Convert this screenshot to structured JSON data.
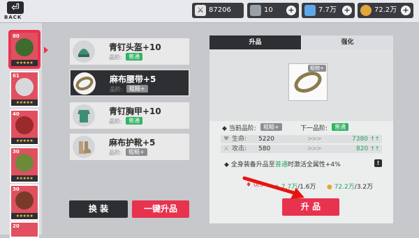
{
  "topbar": {
    "back_label": "BACK",
    "resources": [
      {
        "name": "power",
        "icon": "crossed-swords-icon",
        "value": "87206",
        "has_plus": false
      },
      {
        "name": "stone",
        "icon": "ore-icon",
        "value": "10",
        "has_plus": true
      },
      {
        "name": "diamond",
        "icon": "blue-crystal-icon",
        "value": "7.7万",
        "has_plus": true
      },
      {
        "name": "gold",
        "icon": "gold-coin-icon",
        "value": "72.2万",
        "has_plus": true
      }
    ]
  },
  "heroes": [
    {
      "level": "80",
      "stars": "★★★★★",
      "color": "#e05060",
      "selected": true
    },
    {
      "level": "61",
      "stars": "★★★★★",
      "color": "#e05060",
      "selected": false
    },
    {
      "level": "40",
      "stars": "★★★★★",
      "color": "#e05060",
      "selected": false
    },
    {
      "level": "30",
      "stars": "★★★★★",
      "color": "#e05060",
      "selected": false
    },
    {
      "level": "30",
      "stars": "★★★★★",
      "color": "#e05060",
      "selected": false
    },
    {
      "level": "20",
      "stars": "★★★★★",
      "color": "#e05060",
      "selected": false
    }
  ],
  "equipment": [
    {
      "name": "青钉头盔+10",
      "grade_label": "品阶:",
      "grade": "普通",
      "grade_style": "green",
      "selected": false
    },
    {
      "name": "麻布腰带+5",
      "grade_label": "品阶:",
      "grade": "粗糙+",
      "grade_style": "gray",
      "selected": true
    },
    {
      "name": "青钉胸甲+10",
      "grade_label": "品阶:",
      "grade": "普通",
      "grade_style": "green",
      "selected": false
    },
    {
      "name": "麻布护靴+5",
      "grade_label": "品阶:",
      "grade": "粗糙+",
      "grade_style": "gray",
      "selected": false
    }
  ],
  "buttons": {
    "swap": "换 装",
    "one_click": "一键升品",
    "upgrade": "升 品"
  },
  "tabs": {
    "upgrade_grade": "升品",
    "enhance": "强化"
  },
  "detail": {
    "item_badge": "粗糙+",
    "current_grade_label": "当前品阶:",
    "current_grade": "粗糙+",
    "next_grade_label": "下一品阶:",
    "next_grade": "普通",
    "stats": [
      {
        "label": "生命:",
        "icon": "heart-icon",
        "current": "5220",
        "next": "7380",
        "arrows": "↑↑"
      },
      {
        "label": "攻击:",
        "icon": "sword-icon",
        "current": "580",
        "next": "820",
        "arrows": "↑↑"
      }
    ],
    "note_prefix": "全身装备升品至",
    "note_grade": "普通",
    "note_suffix": "时激活全属性+4%",
    "note_warn": "!"
  },
  "cost": [
    {
      "icon": "red-gem-icon",
      "text": "0/5"
    },
    {
      "icon": "blue-crystal-icon",
      "have": "7.7万",
      "need": "/1.6万"
    },
    {
      "icon": "gold-coin-icon",
      "have": "72.2万",
      "need": "/3.2万"
    }
  ],
  "colors": {
    "accent": "#e8334e",
    "green": "#23a35a",
    "dark": "#2e2f33"
  }
}
